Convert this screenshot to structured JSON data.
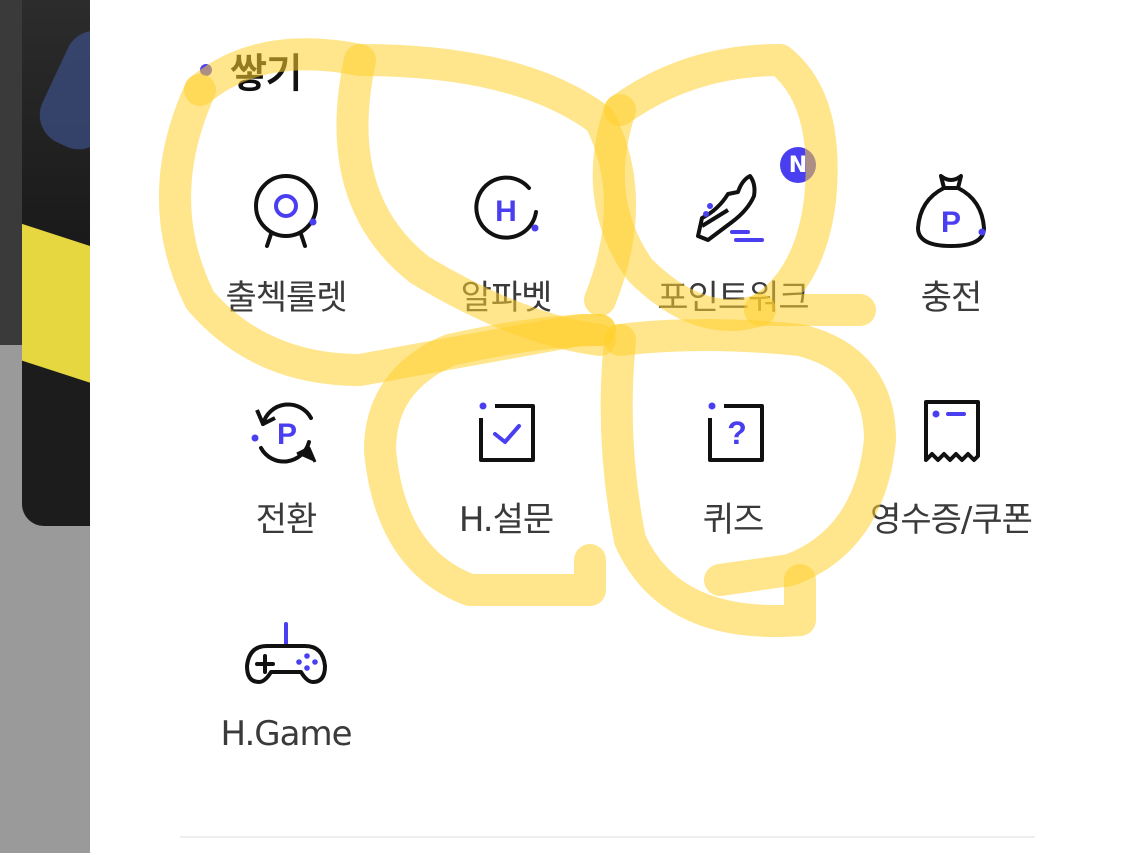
{
  "section": {
    "title": "쌓기"
  },
  "menu": [
    {
      "label": "출첵룰렛",
      "icon": "roulette-icon"
    },
    {
      "label": "알파벳",
      "icon": "alphabet-h-icon"
    },
    {
      "label": "포인트워크",
      "icon": "sneaker-icon",
      "badge": "N"
    },
    {
      "label": "충전",
      "icon": "money-bag-icon"
    },
    {
      "label": "전환",
      "icon": "point-exchange-icon"
    },
    {
      "label": "H.설문",
      "icon": "survey-check-icon"
    },
    {
      "label": "퀴즈",
      "icon": "quiz-icon"
    },
    {
      "label": "영수증/쿠폰",
      "icon": "receipt-icon"
    },
    {
      "label": "H.Game",
      "icon": "gamepad-icon"
    }
  ],
  "colors": {
    "accent": "#4a3ff0",
    "highlighter": "#ffd23f"
  }
}
